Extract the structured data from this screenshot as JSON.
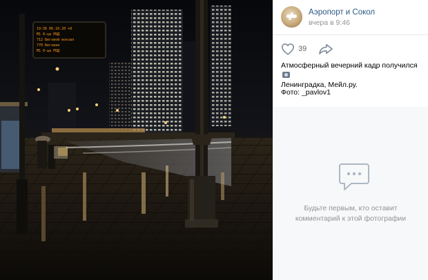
{
  "post": {
    "group_name": "Аэропорт и Сокол",
    "time": "вчера в 9:46",
    "likes": "39",
    "caption_line1": "Атмосферный вечерний кадр получился",
    "caption_line2": "Ленинградка, Мейл.ру.",
    "credit": "Фото: _pavlov1"
  },
  "comments": {
    "empty_text": "Будьте первым, кто оставит комментарий к этой фотографии"
  },
  "photo": {
    "sign_lines": [
      "19:36 06.10.20 +8",
      "М1  0-ца РБД",
      "712 Беговой вокзал",
      "770 Беговая",
      "М1  0-ца РБД"
    ]
  },
  "colors": {
    "link": "#2a5885",
    "muted": "#939393",
    "icon": "#99a2ad"
  },
  "icons": [
    "heart-icon",
    "share-icon",
    "camera-emoji-icon",
    "comment-bubble-icon"
  ]
}
